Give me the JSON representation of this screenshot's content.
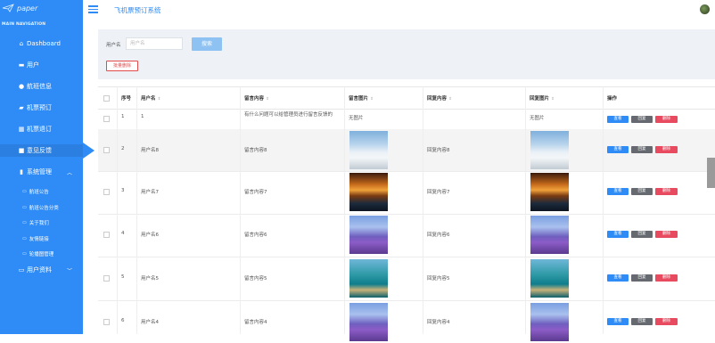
{
  "app": {
    "logo_text": "paper",
    "title": "飞机票预订系统"
  },
  "colors": {
    "primary": "#2f8cf6",
    "danger": "#e84a5f",
    "reply": "#666a70"
  },
  "sidebar": {
    "caption": "MAIN NAVIGATION",
    "items": [
      {
        "label": "Dashboard",
        "icon": "home-icon"
      },
      {
        "label": "用户",
        "icon": "user-icon"
      },
      {
        "label": "航班信息",
        "icon": "person-icon"
      },
      {
        "label": "机票预订",
        "icon": "ticket-icon"
      },
      {
        "label": "机票退订",
        "icon": "grid-icon"
      },
      {
        "label": "意见反馈",
        "icon": "feedback-icon",
        "active": true
      },
      {
        "label": "系统管理",
        "icon": "chart-icon",
        "expanded": true
      },
      {
        "label": "用户资料",
        "icon": "id-card-icon",
        "collapsed": true
      }
    ],
    "sub_items": [
      {
        "label": "航班公告",
        "icon": "folder-icon"
      },
      {
        "label": "航班公告分类",
        "icon": "folder-icon"
      },
      {
        "label": "关于我们",
        "icon": "folder-icon"
      },
      {
        "label": "友情链接",
        "icon": "folder-icon"
      },
      {
        "label": "轮播图管理",
        "icon": "folder-icon"
      }
    ]
  },
  "search": {
    "label": "用户名",
    "placeholder": "用户名",
    "button": "搜索",
    "batch_delete": "批量删除"
  },
  "table": {
    "headers": {
      "index": "序号",
      "username": "用户名",
      "content": "留言内容",
      "image": "留言图片",
      "reply": "回复内容",
      "reply_image": "回复图片",
      "actions": "操作"
    },
    "actions": {
      "view": "查看",
      "reply": "回复",
      "delete": "删除"
    },
    "no_image": "无图片",
    "rows": [
      {
        "index": "1",
        "username": "1",
        "content": "有什么问题可以给管理员进行留言反馈的",
        "image": "none",
        "reply": "",
        "reply_image": "none"
      },
      {
        "index": "2",
        "username": "用户名8",
        "content": "留言内容8",
        "image": "snow-mountain",
        "reply": "回复内容8",
        "reply_image": "snow-mountain"
      },
      {
        "index": "3",
        "username": "用户名7",
        "content": "留言内容7",
        "image": "sunset",
        "reply": "回复内容7",
        "reply_image": "sunset"
      },
      {
        "index": "4",
        "username": "用户名6",
        "content": "留言内容6",
        "image": "lavender",
        "reply": "回复内容6",
        "reply_image": "lavender"
      },
      {
        "index": "5",
        "username": "用户名5",
        "content": "留言内容5",
        "image": "sea-arch",
        "reply": "回复内容5",
        "reply_image": "sea-arch"
      },
      {
        "index": "6",
        "username": "用户名4",
        "content": "留言内容4",
        "image": "lavender",
        "reply": "回复内容4",
        "reply_image": "lavender"
      }
    ]
  }
}
